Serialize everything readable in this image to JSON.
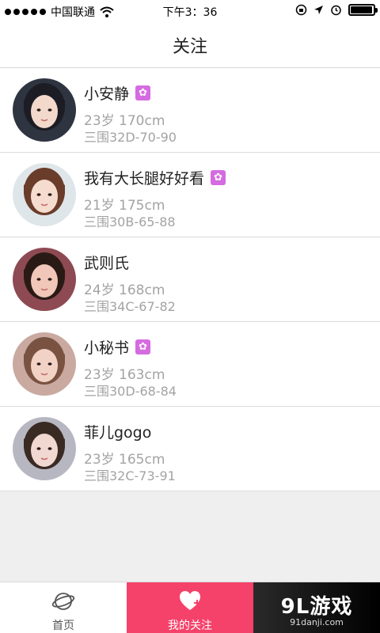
{
  "status_bar": {
    "carrier": "中国联通",
    "time": "下午3：36",
    "battery_level": 0.95
  },
  "nav": {
    "title": "关注"
  },
  "profiles": [
    {
      "name": "小安静",
      "verified": true,
      "age_height": "23岁 170cm",
      "measurements": "三围32D-70-90",
      "avatar_colors": [
        "#2e3440",
        "#f2d9cc",
        "#1c1c24"
      ]
    },
    {
      "name": "我有大长腿好好看",
      "verified": true,
      "age_height": "21岁 175cm",
      "measurements": "三围30B-65-88",
      "avatar_colors": [
        "#dfe6ea",
        "#f5dccf",
        "#6a3c2a"
      ]
    },
    {
      "name": "武则氏",
      "verified": false,
      "age_height": "24岁 168cm",
      "measurements": "三围34C-67-82",
      "avatar_colors": [
        "#8e4a52",
        "#f0c7b8",
        "#2a1a16"
      ]
    },
    {
      "name": "小秘书",
      "verified": true,
      "age_height": "23岁 163cm",
      "measurements": "三围30D-68-84",
      "avatar_colors": [
        "#c9a9a0",
        "#f3d2c6",
        "#7a5242"
      ]
    },
    {
      "name": "菲儿gogo",
      "verified": false,
      "age_height": "23岁 165cm",
      "measurements": "三围32C-73-91",
      "avatar_colors": [
        "#b7b7c2",
        "#f1d8d0",
        "#3a2a24"
      ]
    }
  ],
  "tabs": {
    "home_label": "首页",
    "follow_label": "我的关注"
  },
  "watermark": {
    "logo": "9L游戏",
    "url": "91danji.com"
  },
  "colors": {
    "accent": "#f5426a",
    "badge": "#d56be0",
    "secondary_text": "#a3a3a3"
  }
}
